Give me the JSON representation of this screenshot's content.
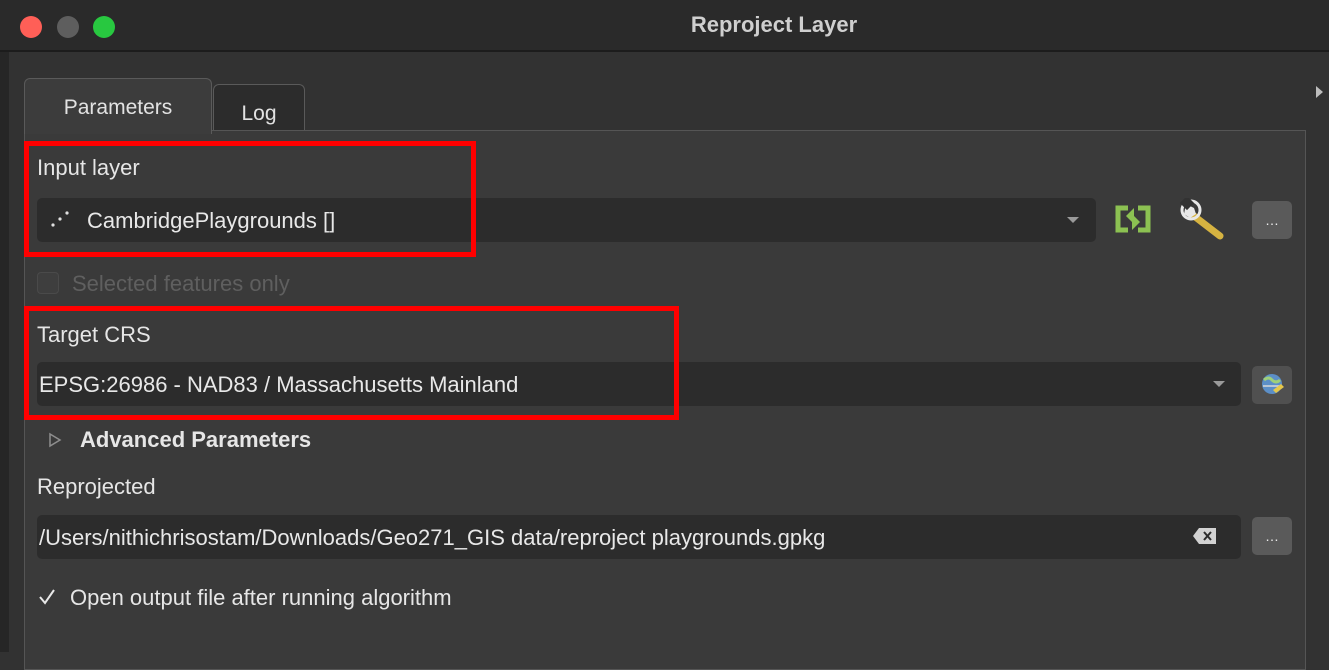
{
  "window": {
    "title": "Reproject Layer"
  },
  "tabs": [
    {
      "label": "Parameters",
      "active": true
    },
    {
      "label": "Log",
      "active": false
    }
  ],
  "input_layer": {
    "label": "Input layer",
    "value": "CambridgePlaygrounds []"
  },
  "selected_features": {
    "label": "Selected features only",
    "checked": false,
    "enabled": false
  },
  "target_crs": {
    "label": "Target CRS",
    "value": "EPSG:26986 - NAD83 / Massachusetts Mainland"
  },
  "advanced": {
    "label": "Advanced Parameters",
    "expanded": false
  },
  "reprojected": {
    "label": "Reprojected",
    "value": "/Users/nithichrisostam/Downloads/Geo271_GIS data/reproject playgrounds.gpkg"
  },
  "open_output": {
    "label": "Open output file after running algorithm",
    "checked": true
  },
  "buttons": {
    "more_label": "…"
  },
  "colors": {
    "highlight": "#ff0000",
    "refresh_icon": "#8cc152"
  }
}
